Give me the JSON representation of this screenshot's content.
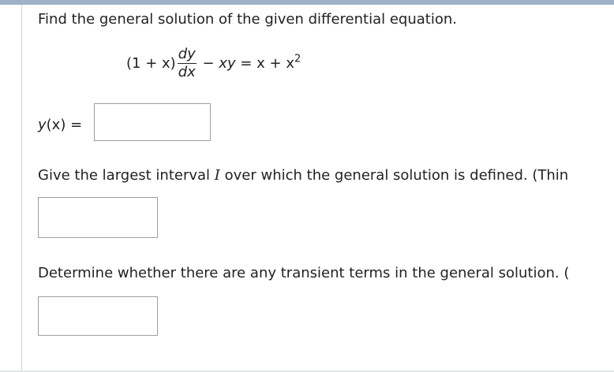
{
  "question1": "Find the general solution of the given differential equation.",
  "equation": {
    "lhs_prefix": "(1 + x)",
    "frac_num": "dy",
    "frac_den": "dx",
    "middle": " − ",
    "xy": "xy",
    "equals": " = x + x",
    "exponent": "2"
  },
  "answer1": {
    "label_y": "y",
    "label_rest": "(x) =",
    "value": ""
  },
  "question2": {
    "before": "Give the largest interval ",
    "var": "I",
    "after": " over which the general solution is defined. (Thin"
  },
  "answer2": {
    "value": ""
  },
  "question3": "Determine whether there are any transient terms in the general solution. (",
  "answer3": {
    "value": ""
  }
}
